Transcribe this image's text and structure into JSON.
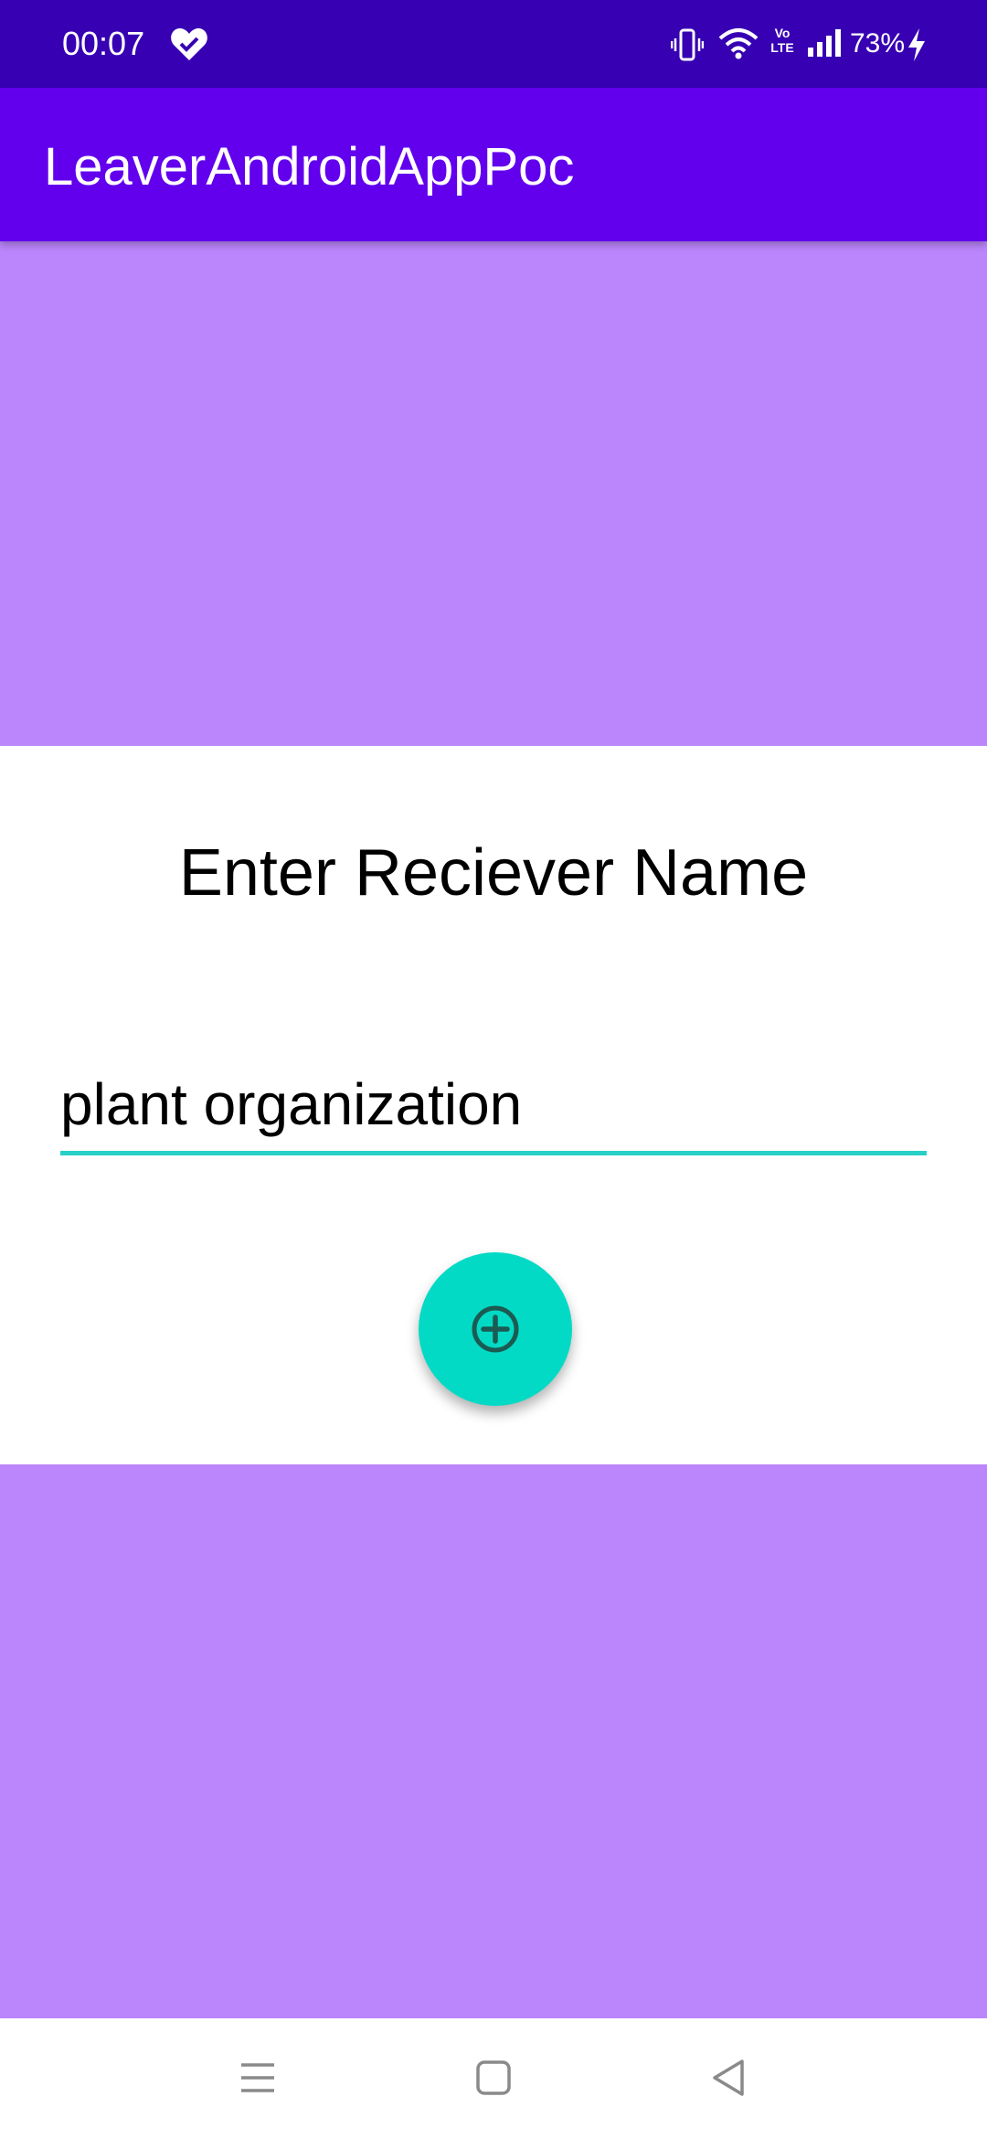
{
  "status_bar": {
    "time": "00:07",
    "battery": "73%",
    "network_badge": [
      "Vo",
      "LTE"
    ],
    "icons": [
      "heart-check-icon",
      "vibrate-icon",
      "wifi-icon",
      "volte-icon",
      "signal-icon",
      "charging-bolt-icon"
    ]
  },
  "app_bar": {
    "title": "LeaverAndroidAppPoc"
  },
  "form": {
    "prompt": "Enter Reciever Name",
    "receiver_name_value": "plant organization",
    "add_button_icon": "add-circle-icon"
  },
  "nav_bar": {
    "items": [
      "menu-icon",
      "home-icon",
      "back-icon"
    ]
  },
  "colors": {
    "status_bar": "#3700b3",
    "app_bar": "#6200ee",
    "purple_panels": "#bb86fc",
    "accent_teal": "#03dac5",
    "input_underline": "#26d0c6"
  }
}
